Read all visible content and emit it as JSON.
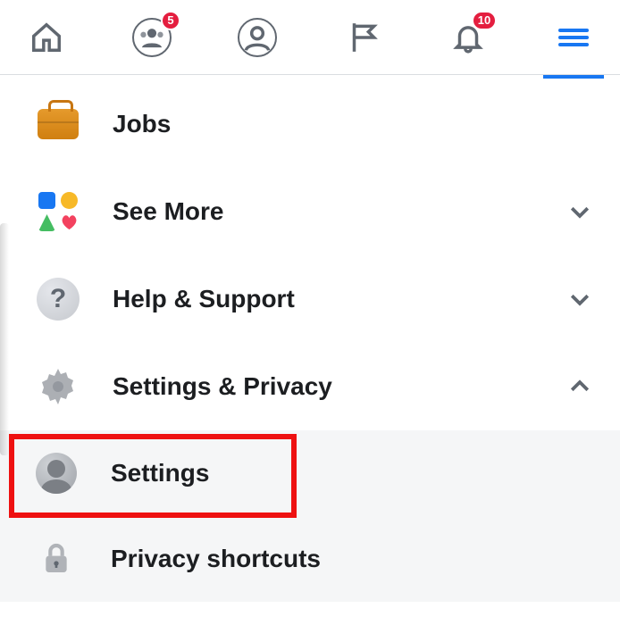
{
  "nav": {
    "friends_badge": "5",
    "notif_badge": "10"
  },
  "menu": {
    "jobs": "Jobs",
    "see_more": "See More",
    "help": "Help & Support",
    "settings_privacy": "Settings & Privacy",
    "settings": "Settings",
    "privacy_shortcuts": "Privacy shortcuts"
  }
}
